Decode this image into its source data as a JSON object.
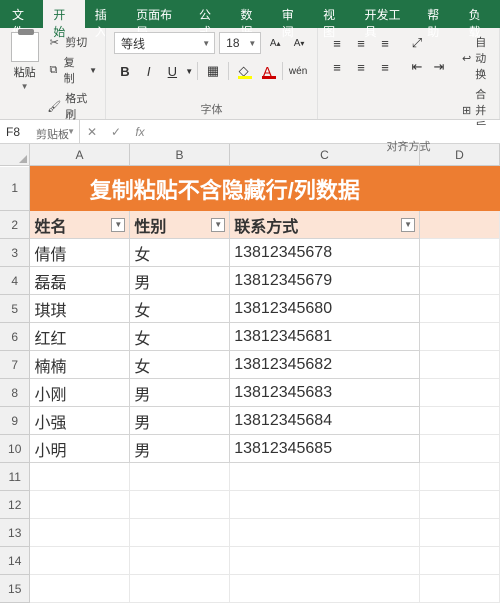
{
  "tabs": [
    "文件",
    "开始",
    "插入",
    "页面布局",
    "公式",
    "数据",
    "审阅",
    "视图",
    "开发工具",
    "帮助",
    "负载"
  ],
  "active_tab_index": 1,
  "clipboard": {
    "paste": "粘贴",
    "cut": "剪切",
    "copy": "复制",
    "format_painter": "格式刷",
    "group": "剪贴板"
  },
  "font": {
    "group": "字体",
    "name": "等线",
    "size": "18",
    "bold": "B",
    "italic": "I",
    "underline": "U",
    "grow": "A",
    "shrink": "A",
    "phonetic": "wén"
  },
  "align": {
    "group": "对齐方式",
    "wrap": "自动换",
    "merge": "合并后"
  },
  "namebox": "F8",
  "fx": "fx",
  "formula": "",
  "columns": [
    "A",
    "B",
    "C",
    "D"
  ],
  "title": "复制粘贴不含隐藏行/列数据",
  "headers": [
    "姓名",
    "性别",
    "联系方式"
  ],
  "rows": [
    {
      "n": "3",
      "a": "倩倩",
      "b": "女",
      "c": "13812345678"
    },
    {
      "n": "4",
      "a": "磊磊",
      "b": "男",
      "c": "13812345679"
    },
    {
      "n": "5",
      "a": "琪琪",
      "b": "女",
      "c": "13812345680"
    },
    {
      "n": "6",
      "a": "红红",
      "b": "女",
      "c": "13812345681"
    },
    {
      "n": "7",
      "a": "楠楠",
      "b": "女",
      "c": "13812345682"
    },
    {
      "n": "8",
      "a": "小刚",
      "b": "男",
      "c": "13812345683"
    },
    {
      "n": "9",
      "a": "小强",
      "b": "男",
      "c": "13812345684"
    },
    {
      "n": "10",
      "a": "小明",
      "b": "男",
      "c": "13812345685"
    }
  ],
  "empty_rows": [
    "11",
    "12",
    "13",
    "14",
    "15"
  ]
}
